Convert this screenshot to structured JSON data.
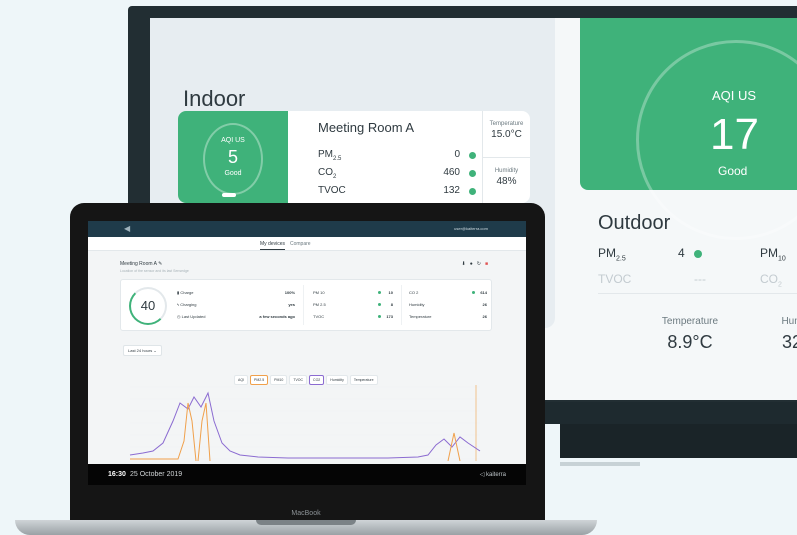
{
  "monitor": {
    "indoor": {
      "title": "Indoor",
      "room": {
        "aqi_label": "AQI US",
        "aqi_value": "5",
        "aqi_condition": "Good",
        "name": "Meeting Room A",
        "metrics": [
          {
            "label": "PM",
            "sub": "2.5",
            "value": "0"
          },
          {
            "label": "CO",
            "sub": "2",
            "value": "460"
          },
          {
            "label": "TVOC",
            "sub": "",
            "value": "132"
          }
        ],
        "temperature_label": "Temperature",
        "temperature_value": "15.0°C",
        "humidity_label": "Humidity",
        "humidity_value": "48%"
      }
    },
    "outdoor": {
      "aqi_label": "AQI US",
      "aqi_value": "17",
      "aqi_condition": "Good",
      "title": "Outdoor",
      "pm25_label": "PM",
      "pm25_sub": "2.5",
      "pm25_value": "4",
      "pm10_label": "PM",
      "pm10_sub": "10",
      "tvoc_label": "TVOC",
      "tvoc_value": "---",
      "co2_label": "CO",
      "co2_sub": "2",
      "temperature_label": "Temperature",
      "temperature_value": "8.9°C",
      "humidity_label": "Hum",
      "humidity_value": "32"
    },
    "accent_color": "#3fb27a"
  },
  "laptop": {
    "brand_label": "MacBook",
    "app": {
      "user_email": "user@kaiterra.com",
      "tabs": [
        {
          "label": "My devices",
          "active": true
        },
        {
          "label": "Compare",
          "active": false
        }
      ],
      "device_title": "Meeting Room A",
      "device_subtitle": "Location of the sensor and its last Sensedge",
      "aqi_value": "40",
      "status_rows": [
        {
          "label": "Charge",
          "value": "100%"
        },
        {
          "label": "Charging",
          "value": "yes"
        },
        {
          "label": "Last Updated",
          "value": "a few seconds ago"
        }
      ],
      "pm_rows": [
        {
          "label": "PM 10",
          "value": "10"
        },
        {
          "label": "PM 2.5",
          "value": "8"
        },
        {
          "label": "TVOC",
          "value": "173"
        }
      ],
      "env_rows": [
        {
          "label": "CO 2",
          "value": "614"
        },
        {
          "label": "Humidity",
          "value": "26"
        },
        {
          "label": "Temperature",
          "value": "26"
        }
      ],
      "range_select": "Last 24 hours",
      "chart_buttons": [
        "AQI",
        "PM2.5",
        "PM10",
        "TVOC",
        "CO2",
        "Humidity",
        "Temperature"
      ]
    },
    "taskbar": {
      "time": "16:30",
      "date": "25 October 2019",
      "brand": "kaiterra"
    }
  }
}
